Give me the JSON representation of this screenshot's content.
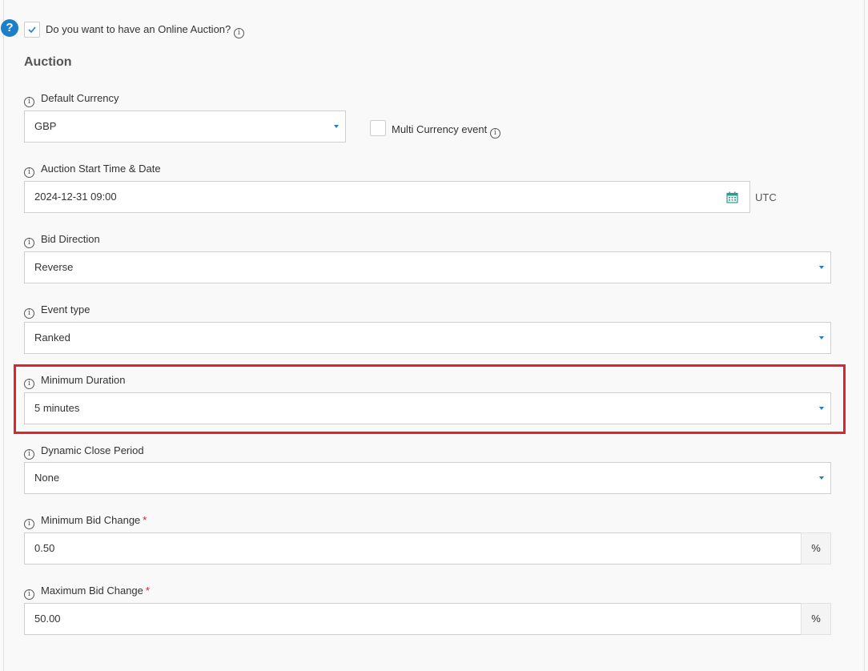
{
  "online_auction": {
    "help_glyph": "?",
    "question": "Do you want to have an Online Auction?",
    "checked": true
  },
  "section_title": "Auction",
  "info_glyph": "i",
  "fields": {
    "default_currency": {
      "label": "Default Currency",
      "value": "GBP"
    },
    "multi_currency": {
      "label": "Multi Currency event",
      "checked": false
    },
    "start_time": {
      "label": "Auction Start Time & Date",
      "value": "2024-12-31 09:00",
      "timezone": "UTC"
    },
    "bid_direction": {
      "label": "Bid Direction",
      "value": "Reverse"
    },
    "event_type": {
      "label": "Event type",
      "value": "Ranked"
    },
    "minimum_duration": {
      "label": "Minimum Duration",
      "value": "5 minutes"
    },
    "dynamic_close_period": {
      "label": "Dynamic Close Period",
      "value": "None"
    },
    "minimum_bid_change": {
      "label": "Minimum Bid Change",
      "value": "0.50",
      "unit": "%",
      "required_mark": "*"
    },
    "maximum_bid_change": {
      "label": "Maximum Bid Change",
      "value": "50.00",
      "unit": "%",
      "required_mark": "*"
    }
  },
  "colors": {
    "accent": "#1e7fc8",
    "highlight": "#e0232d",
    "required": "#cc1f1f",
    "calendar_icon": "#2a9d8f"
  }
}
